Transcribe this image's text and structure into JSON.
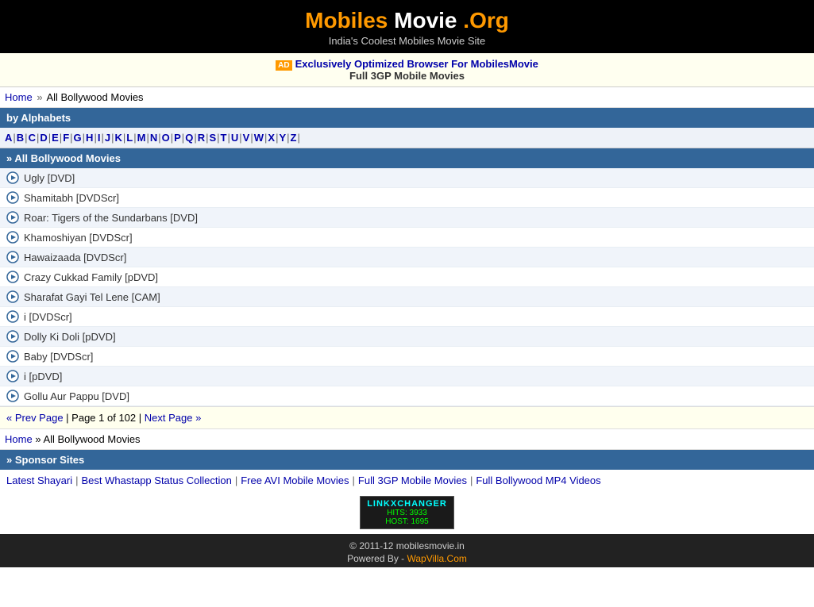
{
  "header": {
    "title_mobiles": "Mobiles",
    "title_movie": " Movie",
    "title_org": " .Org",
    "tagline": "India's Coolest Mobiles Movie Site"
  },
  "ad": {
    "label": "AD",
    "link_text": "Exclusively Optimized Browser For MobilesMovie",
    "line2": "Full 3GP Mobile Movies"
  },
  "breadcrumb": {
    "home": "Home",
    "sep": "»",
    "current": "All Bollywood Movies"
  },
  "alphabets_header": "by Alphabets",
  "alphabet_links": [
    "A",
    "B",
    "C",
    "D",
    "E",
    "F",
    "G",
    "H",
    "I",
    "J",
    "K",
    "L",
    "M",
    "N",
    "O",
    "P",
    "Q",
    "R",
    "S",
    "T",
    "U",
    "V",
    "W",
    "X",
    "Y",
    "Z"
  ],
  "movies_section_header": "» All Bollywood Movies",
  "movies": [
    {
      "title": "Ugly [DVD]"
    },
    {
      "title": "Shamitabh [DVDScr]"
    },
    {
      "title": "Roar: Tigers of the Sundarbans [DVD]"
    },
    {
      "title": "Khamoshiyan [DVDScr]"
    },
    {
      "title": "Hawaizaada [DVDScr]"
    },
    {
      "title": "Crazy Cukkad Family [pDVD]"
    },
    {
      "title": "Sharafat Gayi Tel Lene [CAM]"
    },
    {
      "title": "i [DVDScr]"
    },
    {
      "title": "Dolly Ki Doli [pDVD]"
    },
    {
      "title": "Baby [DVDScr]"
    },
    {
      "title": "i [pDVD]"
    },
    {
      "title": "Gollu Aur Pappu [DVD]"
    }
  ],
  "pagination": {
    "prev": "« Prev Page",
    "page_info": "Page 1 of 102",
    "next": "Next Page »"
  },
  "sponsor_header": "» Sponsor Sites",
  "sponsor_links": [
    {
      "label": "Latest Shayari"
    },
    {
      "label": "Best Whastapp Status Collection"
    },
    {
      "label": "Free AVI Mobile Movies"
    },
    {
      "label": "Full 3GP Mobile Movies"
    },
    {
      "label": "Full Bollywood MP4 Videos"
    }
  ],
  "linkxchanger": {
    "title": "LINKXCHANGER",
    "hits": "HITS: 3933",
    "host": "HOST: 1695"
  },
  "footer": {
    "copyright": "© 2011-12 mobilesmovie.in",
    "powered_text": "Powered By -",
    "powered_link": "WapVilla.Com"
  }
}
